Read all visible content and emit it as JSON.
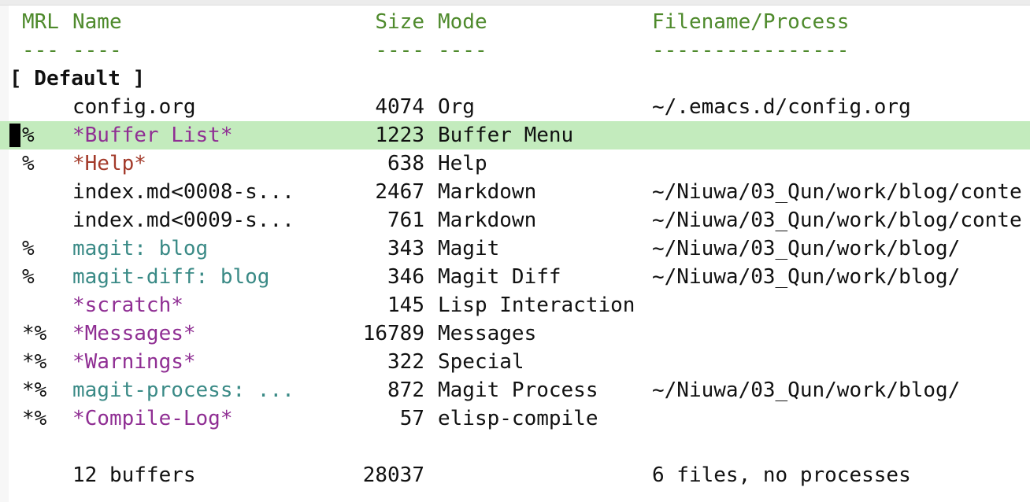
{
  "header": {
    "mrl": "MRL",
    "name": "Name",
    "size": "Size",
    "mode": "Mode",
    "file": "Filename/Process",
    "u_mrl": "---",
    "u_name": "----",
    "u_size": "----",
    "u_mode": "----",
    "u_file": "----------------"
  },
  "group": "[ Default ]",
  "buffers": [
    {
      "mrl": "",
      "name": "config.org",
      "size": "4074",
      "mode": "Org",
      "file": "~/.emacs.d/config.org",
      "name_color": "#111111"
    },
    {
      "mrl": "%",
      "name": "*Buffer List*",
      "size": "1223",
      "mode": "Buffer Menu",
      "file": "",
      "name_color": "#8f2e93",
      "current": true
    },
    {
      "mrl": "%",
      "name": "*Help*",
      "size": "638",
      "mode": "Help",
      "file": "",
      "name_color": "#a33a2a"
    },
    {
      "mrl": "",
      "name": "index.md<0008-s...",
      "size": "2467",
      "mode": "Markdown",
      "file": "~/Niuwa/03_Qun/work/blog/conte",
      "name_color": "#111111"
    },
    {
      "mrl": "",
      "name": "index.md<0009-s...",
      "size": "761",
      "mode": "Markdown",
      "file": "~/Niuwa/03_Qun/work/blog/conte",
      "name_color": "#111111"
    },
    {
      "mrl": "%",
      "name": "magit: blog",
      "size": "343",
      "mode": "Magit",
      "file": "~/Niuwa/03_Qun/work/blog/",
      "name_color": "#3a8a86"
    },
    {
      "mrl": "%",
      "name": "magit-diff: blog",
      "size": "346",
      "mode": "Magit Diff",
      "file": "~/Niuwa/03_Qun/work/blog/",
      "name_color": "#3a8a86"
    },
    {
      "mrl": "",
      "name": "*scratch*",
      "size": "145",
      "mode": "Lisp Interaction",
      "file": "",
      "name_color": "#8f2e93"
    },
    {
      "mrl": "*%",
      "name": "*Messages*",
      "size": "16789",
      "mode": "Messages",
      "file": "",
      "name_color": "#8f2e93"
    },
    {
      "mrl": "*%",
      "name": "*Warnings*",
      "size": "322",
      "mode": "Special",
      "file": "",
      "name_color": "#8f2e93"
    },
    {
      "mrl": "*%",
      "name": "magit-process: ...",
      "size": "872",
      "mode": "Magit Process",
      "file": "~/Niuwa/03_Qun/work/blog/",
      "name_color": "#3a8a86"
    },
    {
      "mrl": "*%",
      "name": "*Compile-Log*",
      "size": "57",
      "mode": "elisp-compile",
      "file": "",
      "name_color": "#8f2e93"
    }
  ],
  "footer": {
    "count": "12 buffers",
    "total": "28037",
    "summary": "6 files, no processes"
  },
  "colors": {
    "header": "#4e8a2c",
    "current_line": "#c3ebbd",
    "special_buffer": "#8f2e93",
    "help_buffer": "#a33a2a",
    "magit_buffer": "#3a8a86"
  }
}
